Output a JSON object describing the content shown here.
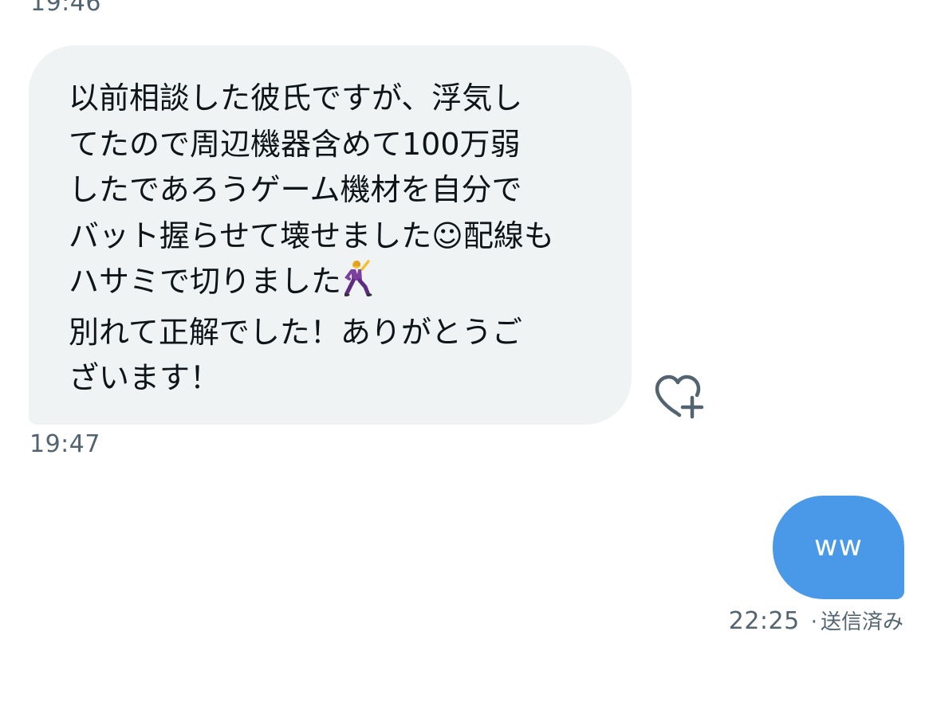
{
  "conversation": {
    "previous_timestamp": "19:46",
    "incoming": {
      "lines": [
        "以前相談した彼氏ですが、浮気し",
        "てたので周辺機器含めて100万弱",
        "したであろうゲーム機材を自分で",
        "バット握らせて壊せました☺配線も",
        "ハサミで切りました",
        "別れて正解でした！ありがとうご",
        "ざいます！"
      ],
      "timestamp": "19:47",
      "reaction_icon": "heart-plus-icon"
    },
    "outgoing": {
      "text": "ww",
      "timestamp": "22:25",
      "separator": "·",
      "status": "送信済み"
    }
  },
  "colors": {
    "incoming_bubble": "#eff3f4",
    "outgoing_bubble": "#4a99e9",
    "meta_text": "#536471",
    "body_text": "#0f1419"
  }
}
